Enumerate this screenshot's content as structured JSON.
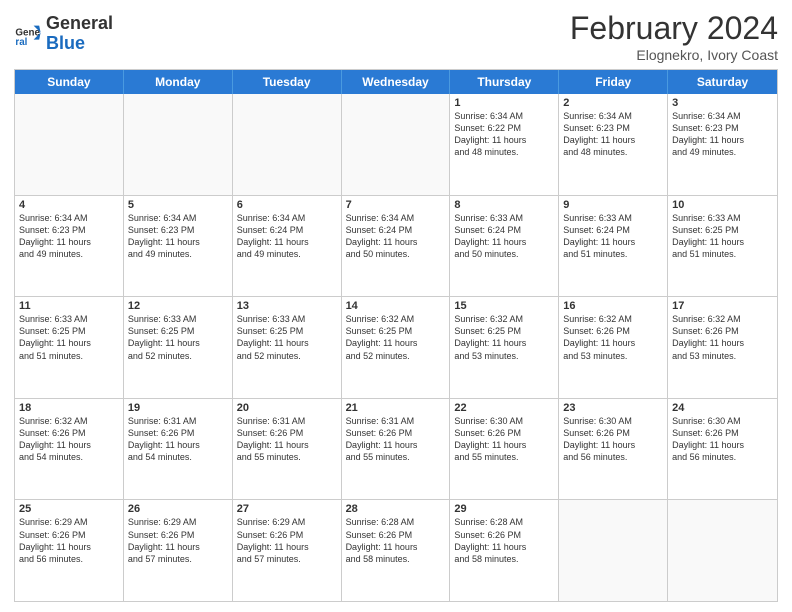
{
  "header": {
    "logo_general": "General",
    "logo_blue": "Blue",
    "month_title": "February 2024",
    "subtitle": "Elognekro, Ivory Coast"
  },
  "weekdays": [
    "Sunday",
    "Monday",
    "Tuesday",
    "Wednesday",
    "Thursday",
    "Friday",
    "Saturday"
  ],
  "rows": [
    [
      {
        "day": "",
        "info": ""
      },
      {
        "day": "",
        "info": ""
      },
      {
        "day": "",
        "info": ""
      },
      {
        "day": "",
        "info": ""
      },
      {
        "day": "1",
        "info": "Sunrise: 6:34 AM\nSunset: 6:22 PM\nDaylight: 11 hours\nand 48 minutes."
      },
      {
        "day": "2",
        "info": "Sunrise: 6:34 AM\nSunset: 6:23 PM\nDaylight: 11 hours\nand 48 minutes."
      },
      {
        "day": "3",
        "info": "Sunrise: 6:34 AM\nSunset: 6:23 PM\nDaylight: 11 hours\nand 49 minutes."
      }
    ],
    [
      {
        "day": "4",
        "info": "Sunrise: 6:34 AM\nSunset: 6:23 PM\nDaylight: 11 hours\nand 49 minutes."
      },
      {
        "day": "5",
        "info": "Sunrise: 6:34 AM\nSunset: 6:23 PM\nDaylight: 11 hours\nand 49 minutes."
      },
      {
        "day": "6",
        "info": "Sunrise: 6:34 AM\nSunset: 6:24 PM\nDaylight: 11 hours\nand 49 minutes."
      },
      {
        "day": "7",
        "info": "Sunrise: 6:34 AM\nSunset: 6:24 PM\nDaylight: 11 hours\nand 50 minutes."
      },
      {
        "day": "8",
        "info": "Sunrise: 6:33 AM\nSunset: 6:24 PM\nDaylight: 11 hours\nand 50 minutes."
      },
      {
        "day": "9",
        "info": "Sunrise: 6:33 AM\nSunset: 6:24 PM\nDaylight: 11 hours\nand 51 minutes."
      },
      {
        "day": "10",
        "info": "Sunrise: 6:33 AM\nSunset: 6:25 PM\nDaylight: 11 hours\nand 51 minutes."
      }
    ],
    [
      {
        "day": "11",
        "info": "Sunrise: 6:33 AM\nSunset: 6:25 PM\nDaylight: 11 hours\nand 51 minutes."
      },
      {
        "day": "12",
        "info": "Sunrise: 6:33 AM\nSunset: 6:25 PM\nDaylight: 11 hours\nand 52 minutes."
      },
      {
        "day": "13",
        "info": "Sunrise: 6:33 AM\nSunset: 6:25 PM\nDaylight: 11 hours\nand 52 minutes."
      },
      {
        "day": "14",
        "info": "Sunrise: 6:32 AM\nSunset: 6:25 PM\nDaylight: 11 hours\nand 52 minutes."
      },
      {
        "day": "15",
        "info": "Sunrise: 6:32 AM\nSunset: 6:25 PM\nDaylight: 11 hours\nand 53 minutes."
      },
      {
        "day": "16",
        "info": "Sunrise: 6:32 AM\nSunset: 6:26 PM\nDaylight: 11 hours\nand 53 minutes."
      },
      {
        "day": "17",
        "info": "Sunrise: 6:32 AM\nSunset: 6:26 PM\nDaylight: 11 hours\nand 53 minutes."
      }
    ],
    [
      {
        "day": "18",
        "info": "Sunrise: 6:32 AM\nSunset: 6:26 PM\nDaylight: 11 hours\nand 54 minutes."
      },
      {
        "day": "19",
        "info": "Sunrise: 6:31 AM\nSunset: 6:26 PM\nDaylight: 11 hours\nand 54 minutes."
      },
      {
        "day": "20",
        "info": "Sunrise: 6:31 AM\nSunset: 6:26 PM\nDaylight: 11 hours\nand 55 minutes."
      },
      {
        "day": "21",
        "info": "Sunrise: 6:31 AM\nSunset: 6:26 PM\nDaylight: 11 hours\nand 55 minutes."
      },
      {
        "day": "22",
        "info": "Sunrise: 6:30 AM\nSunset: 6:26 PM\nDaylight: 11 hours\nand 55 minutes."
      },
      {
        "day": "23",
        "info": "Sunrise: 6:30 AM\nSunset: 6:26 PM\nDaylight: 11 hours\nand 56 minutes."
      },
      {
        "day": "24",
        "info": "Sunrise: 6:30 AM\nSunset: 6:26 PM\nDaylight: 11 hours\nand 56 minutes."
      }
    ],
    [
      {
        "day": "25",
        "info": "Sunrise: 6:29 AM\nSunset: 6:26 PM\nDaylight: 11 hours\nand 56 minutes."
      },
      {
        "day": "26",
        "info": "Sunrise: 6:29 AM\nSunset: 6:26 PM\nDaylight: 11 hours\nand 57 minutes."
      },
      {
        "day": "27",
        "info": "Sunrise: 6:29 AM\nSunset: 6:26 PM\nDaylight: 11 hours\nand 57 minutes."
      },
      {
        "day": "28",
        "info": "Sunrise: 6:28 AM\nSunset: 6:26 PM\nDaylight: 11 hours\nand 58 minutes."
      },
      {
        "day": "29",
        "info": "Sunrise: 6:28 AM\nSunset: 6:26 PM\nDaylight: 11 hours\nand 58 minutes."
      },
      {
        "day": "",
        "info": ""
      },
      {
        "day": "",
        "info": ""
      }
    ]
  ]
}
